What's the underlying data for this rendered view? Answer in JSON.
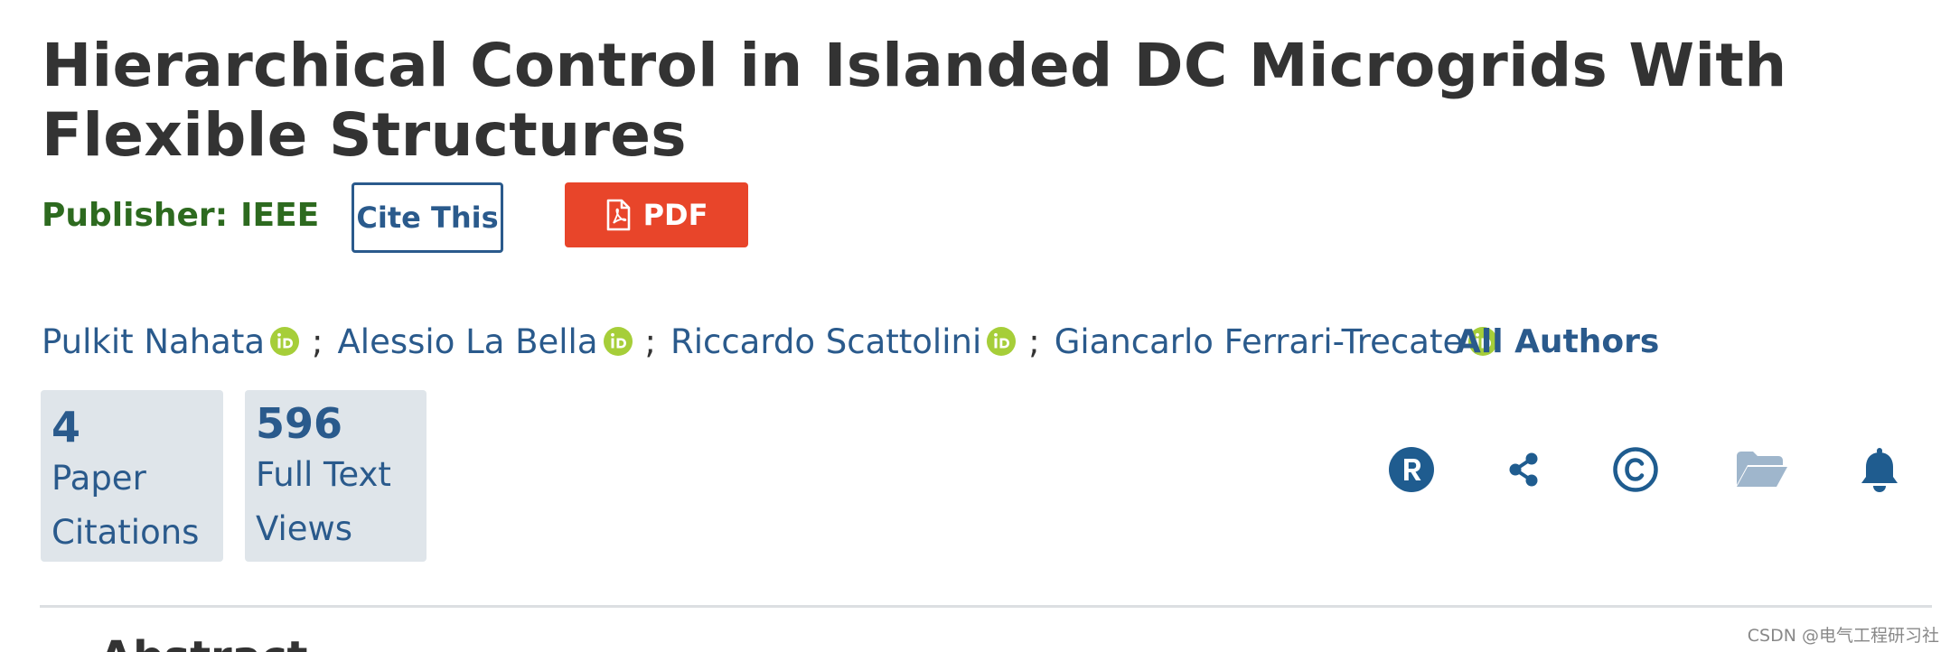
{
  "article": {
    "title": "Hierarchical Control in Islanded DC Microgrids With Flexible Structures",
    "publisher_label": "Publisher:",
    "publisher_value": "IEEE"
  },
  "actions": {
    "cite_label": "Cite This",
    "pdf_label": "PDF"
  },
  "authors": {
    "list": [
      {
        "name": "Pulkit Nahata"
      },
      {
        "name": "Alessio La Bella"
      },
      {
        "name": "Riccardo Scattolini"
      },
      {
        "name": "Giancarlo Ferrari-Trecate"
      }
    ],
    "separator": ";",
    "all_authors_label": "All Authors"
  },
  "metrics": {
    "citations": {
      "count": "4",
      "label": "Paper Citations"
    },
    "views": {
      "count": "596",
      "label": "Full Text Views"
    }
  },
  "tool_icons": [
    "rights-icon",
    "share-icon",
    "copyright-icon",
    "folder-icon",
    "bell-icon"
  ],
  "colors": {
    "title": "#333333",
    "publisher": "#2d6a1f",
    "link": "#2a5a8c",
    "pdf_button": "#e8452a",
    "orcid": "#a6ce39",
    "metric_bg": "#dfe5ea",
    "folder_icon": "#9fb6cc"
  },
  "section_peek": "Abstract",
  "watermark": "CSDN @电气工程研习社"
}
